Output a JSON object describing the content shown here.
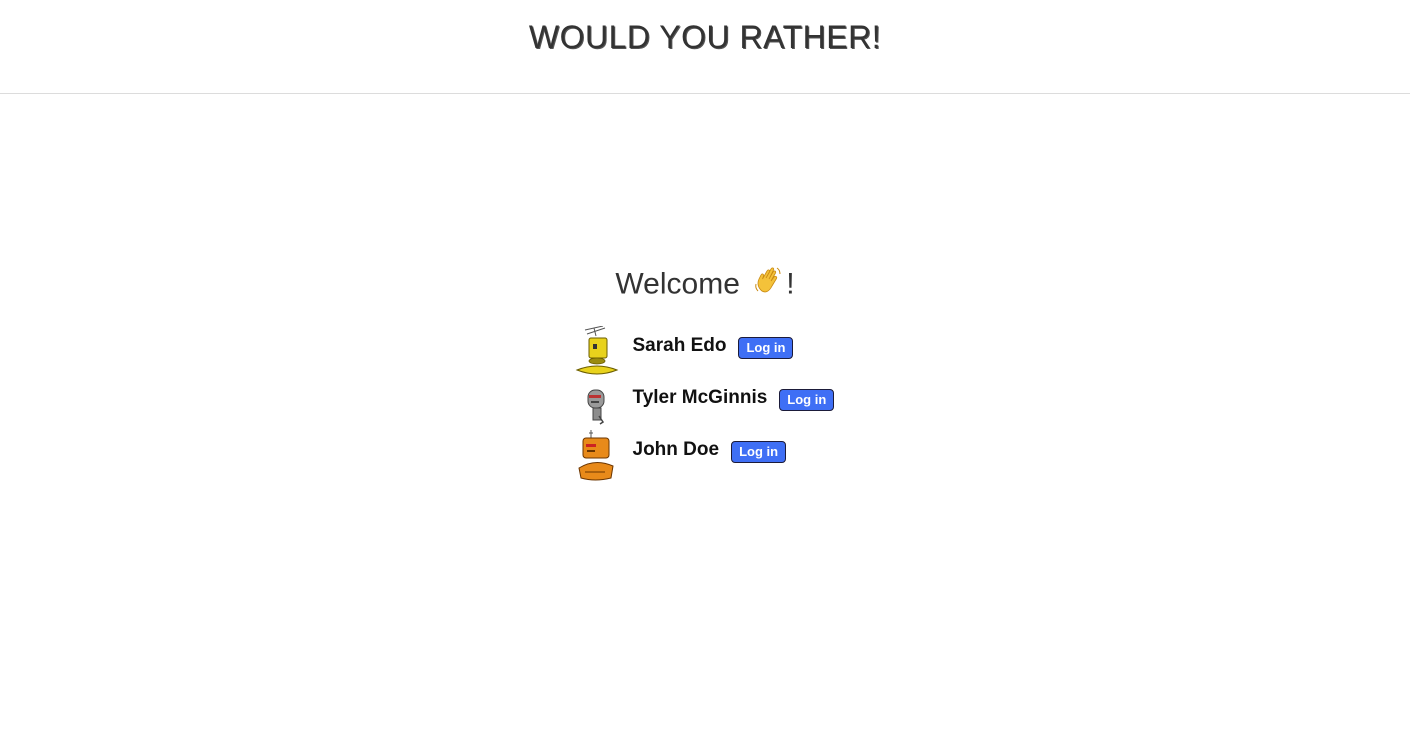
{
  "header": {
    "title": "WOULD YOU RATHER!"
  },
  "welcome": {
    "text_before": "Welcome ",
    "emoji": "👋",
    "text_after": "!"
  },
  "users": [
    {
      "name": "Sarah Edo",
      "login_label": "Log in",
      "avatar_icon": "yellow-robot-avatar",
      "avatar_color": "#e8d21c"
    },
    {
      "name": "Tyler McGinnis",
      "login_label": "Log in",
      "avatar_icon": "gray-robot-avatar",
      "avatar_color": "#8d8d8d"
    },
    {
      "name": "John Doe",
      "login_label": "Log in",
      "avatar_icon": "orange-robot-avatar",
      "avatar_color": "#e88a1a"
    }
  ],
  "colors": {
    "button": "#3f6ff5",
    "divider": "#dcdcdc"
  }
}
